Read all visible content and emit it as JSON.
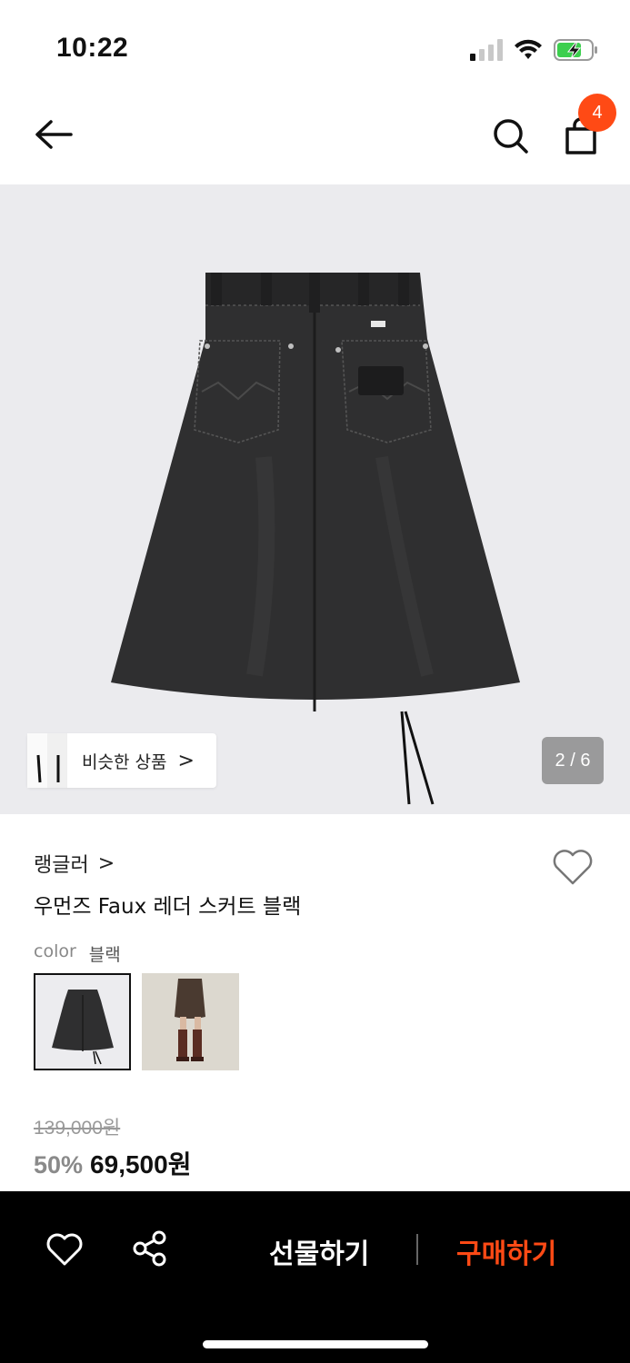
{
  "status_bar": {
    "time": "10:22"
  },
  "header": {
    "back_icon": "arrow-left-icon",
    "search_icon": "search-icon",
    "cart_icon": "shopping-bag-icon",
    "cart_count": "4"
  },
  "hero": {
    "similar_label": "비슷한 상품",
    "similar_chevron": ">",
    "page_indicator": "2 / 6",
    "background": "#ebebee"
  },
  "product": {
    "brand": "랭글러",
    "brand_chevron": ">",
    "name": "우먼즈 Faux 레더 스커트 블랙",
    "color_key": "color",
    "color_value": "블랙",
    "original_price": "139,000원",
    "discount": "50%",
    "final_price": "69,500원"
  },
  "bottom_bar": {
    "gift_label": "선물하기",
    "buy_label": "구매하기",
    "buy_color": "#ff4a15"
  }
}
